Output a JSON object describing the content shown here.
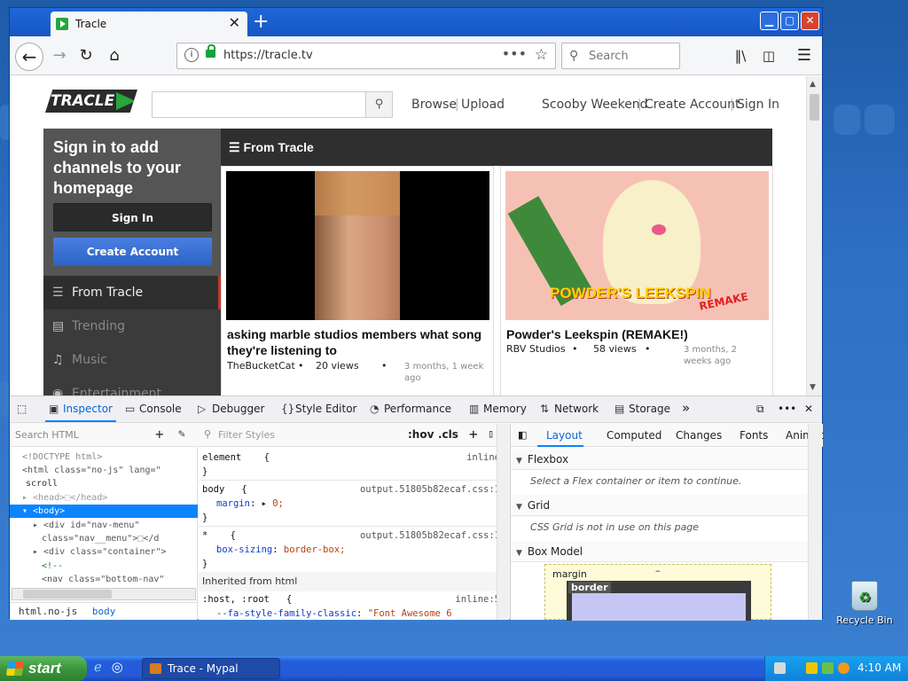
{
  "browser": {
    "tab_title": "Tracle",
    "tab_close": "✕",
    "new_tab": "+",
    "url": "https://tracle.tv",
    "search_placeholder": "Search",
    "window_buttons": {
      "minimize": "▁",
      "maximize": "▢",
      "close": "✕"
    }
  },
  "site": {
    "logo": "TRACLE",
    "search_button_icon": "magnifier",
    "links": [
      "Browse",
      "Upload",
      "Scooby Weekend",
      "Create Account",
      "Sign In"
    ],
    "sidebar": {
      "heading": "Sign in to add channels to your homepage",
      "sign_in": "Sign In",
      "create_account": "Create Account",
      "items": [
        {
          "label": "From Tracle",
          "icon": "list-icon",
          "active": true
        },
        {
          "label": "Trending",
          "icon": "chart-icon"
        },
        {
          "label": "Music",
          "icon": "headphones-icon"
        },
        {
          "label": "Entertainment",
          "icon": "gamepad-icon"
        }
      ]
    },
    "section_title": "From Tracle",
    "cards": [
      {
        "title": "asking marble studios members what song they're listening to",
        "author": "TheBucketCat",
        "dot1": "•",
        "views": "20 views",
        "dot2": "•",
        "ago": "3 months, 1 week ago"
      },
      {
        "title": "Powder's Leekspin (REMAKE!)",
        "author": "RBV Studios",
        "dot1": "•",
        "views": "58 views",
        "dot2": "•",
        "ago": "3 months, 2 weeks ago",
        "thumb_text": "POWDER'S LEEKSPIN",
        "thumb_tag": "REMAKE"
      }
    ]
  },
  "devtools": {
    "tabs": [
      "Inspector",
      "Console",
      "Debugger",
      "Style Editor",
      "Performance",
      "Memory",
      "Network",
      "Storage"
    ],
    "more": "»",
    "menu": "•••",
    "close": "✕",
    "search_html_placeholder": "Search HTML",
    "html_lines": [
      {
        "text": "<!DOCTYPE html>"
      },
      {
        "text": "<html class=\"no-js\" lang=\""
      },
      {
        "text": "scroll"
      },
      {
        "text": "▸ <head>⬚</head>"
      },
      {
        "text": "▾ <body>",
        "selected": true
      },
      {
        "text": "▸ <div id=\"nav-menu\""
      },
      {
        "text": "class=\"nav__menu\">⬚</d"
      },
      {
        "text": "▸ <div class=\"container\">"
      },
      {
        "text": "<!--"
      },
      {
        "text": "<nav class=\"bottom-nav\""
      }
    ],
    "breadcrumb": [
      "html.no-js",
      "body"
    ],
    "filter_styles_placeholder": "Filter Styles",
    "hov": ":hov",
    "cls": ".cls",
    "rules": [
      {
        "selector": "element",
        "brace_open": "{",
        "source": "inline",
        "brace_close": "}",
        "decls": []
      },
      {
        "selector": "body",
        "brace_open": "{",
        "source": "output.51805b82ecaf.css:1",
        "brace_close": "}",
        "decls": [
          {
            "prop": "margin",
            "value": "0;"
          }
        ]
      },
      {
        "selector": "*",
        "brace_open": "{",
        "source": "output.51805b82ecaf.css:1",
        "brace_close": "}",
        "decls": [
          {
            "prop": "box-sizing",
            "value": "border-box;"
          }
        ]
      }
    ],
    "inherited_label": "Inherited from html",
    "inherited_rule": {
      "selector": ":host, :root",
      "brace_open": "{",
      "source": "inline:5",
      "prop": "--fa-style-family-classic",
      "value": "\"Font Awesome 6"
    },
    "layout_tabs": [
      "Layout",
      "Computed",
      "Changes",
      "Fonts",
      "Animat"
    ],
    "flexbox_title": "Flexbox",
    "flexbox_note": "Select a Flex container or item to continue.",
    "grid_title": "Grid",
    "grid_note": "CSS Grid is not in use on this page",
    "boxmodel_title": "Box Model",
    "boxmodel_margin": "margin",
    "boxmodel_border": "border",
    "boxmodel_dash": "–"
  },
  "desktop": {
    "recycle_bin": "Recycle Bin",
    "start": "start",
    "taskbar_item": "Trace - Mypal",
    "time": "4:10 AM"
  }
}
